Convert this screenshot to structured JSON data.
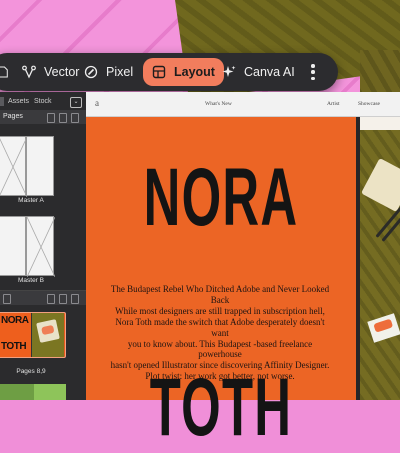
{
  "toolbar": {
    "items": [
      {
        "label": "Vector",
        "icon": "vector-pen-icon"
      },
      {
        "label": "Pixel",
        "icon": "pixel-brush-icon"
      },
      {
        "label": "Layout",
        "icon": "layout-icon",
        "active": true
      },
      {
        "label": "Canva AI",
        "icon": "sparkle-icon"
      }
    ],
    "active_color": "#f27d5d"
  },
  "panel": {
    "tabs": [
      "Assets",
      "Stock"
    ],
    "pages_title": "Pages",
    "masters": [
      {
        "label": "Master A"
      },
      {
        "label": "Master B"
      }
    ],
    "spreads": [
      {
        "label": "Pages 8,9",
        "left_text_top": "NORA",
        "left_text_bottom": "TOTH"
      }
    ]
  },
  "document": {
    "header": {
      "arrow": "a",
      "section": "What's New",
      "mid": "Artist",
      "right": "Showcase"
    },
    "headline_top": "NORA",
    "headline_bottom": "TOTH",
    "body": [
      "The Budapest Rebel Who Ditched Adobe and Never Looked Back",
      "While most designers are still trapped in subscription hell,",
      "Nora Toth made the switch that Adobe desperately doesn't want",
      "you to know about. This Budapest -based freelance powerhouse",
      "hasn't opened Illustrator since discovering Affinity Designer.",
      "Plot twist: her work got better, not worse."
    ],
    "page_color": "#ec6525"
  }
}
